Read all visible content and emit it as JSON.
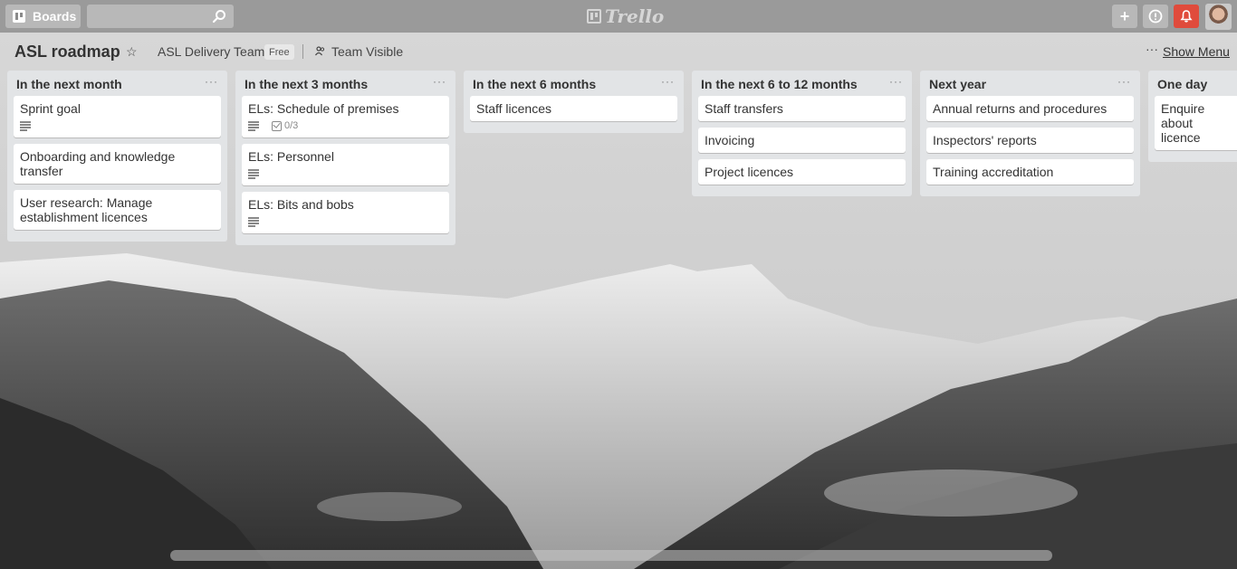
{
  "header": {
    "boards_label": "Boards",
    "search_placeholder": "",
    "logo_text": "Trello"
  },
  "board": {
    "title": "ASL roadmap",
    "team": "ASL Delivery Team",
    "plan_badge": "Free",
    "visibility": "Team Visible",
    "show_menu": "Show Menu"
  },
  "lists": [
    {
      "title": "In the next month",
      "cards": [
        {
          "title": "Sprint goal",
          "has_description": true
        },
        {
          "title": "Onboarding and knowledge transfer"
        },
        {
          "title": "User research: Manage establishment licences"
        }
      ]
    },
    {
      "title": "In the next 3 months",
      "cards": [
        {
          "title": "ELs: Schedule of premises",
          "has_description": true,
          "checklist": "0/3"
        },
        {
          "title": "ELs: Personnel",
          "has_description": true
        },
        {
          "title": "ELs: Bits and bobs",
          "has_description": true
        }
      ]
    },
    {
      "title": "In the next 6 months",
      "cards": [
        {
          "title": "Staff licences"
        }
      ]
    },
    {
      "title": "In the next 6 to 12 months",
      "cards": [
        {
          "title": "Staff transfers"
        },
        {
          "title": "Invoicing"
        },
        {
          "title": "Project licences"
        }
      ]
    },
    {
      "title": "Next year",
      "cards": [
        {
          "title": "Annual returns and procedures"
        },
        {
          "title": "Inspectors' reports"
        },
        {
          "title": "Training accreditation"
        }
      ]
    },
    {
      "title": "One day",
      "cards": [
        {
          "title": "Enquire about licence"
        }
      ]
    }
  ],
  "colors": {
    "notification": "#e04b3c",
    "list_bg": "#e2e4e6",
    "card_bg": "#ffffff"
  }
}
